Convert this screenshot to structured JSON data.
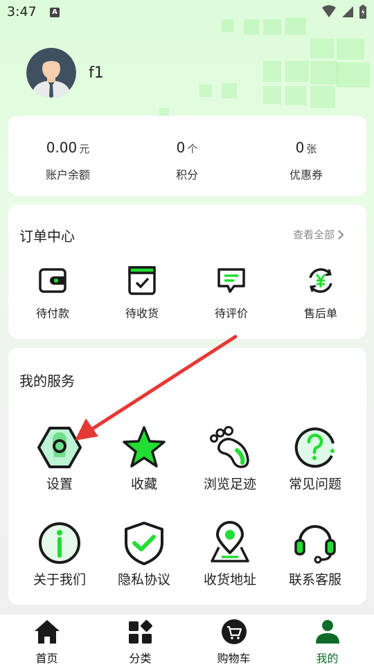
{
  "status_bar": {
    "time": "3:47",
    "notification_badge": "A"
  },
  "profile": {
    "username": "f1"
  },
  "balance_stats": [
    {
      "value": "0.00",
      "unit": "元",
      "label": "账户余额"
    },
    {
      "value": "0",
      "unit": "个",
      "label": "积分"
    },
    {
      "value": "0",
      "unit": "张",
      "label": "优惠券"
    }
  ],
  "orders": {
    "title": "订单中心",
    "view_all": "查看全部",
    "items": [
      {
        "label": "待付款",
        "icon": "wallet-icon"
      },
      {
        "label": "待收货",
        "icon": "package-icon"
      },
      {
        "label": "待评价",
        "icon": "comment-icon"
      },
      {
        "label": "售后单",
        "icon": "refund-icon"
      }
    ]
  },
  "services": {
    "title": "我的服务",
    "items": [
      {
        "label": "设置",
        "icon": "settings-hex-icon"
      },
      {
        "label": "收藏",
        "icon": "star-icon"
      },
      {
        "label": "浏览足迹",
        "icon": "footprint-icon"
      },
      {
        "label": "常见问题",
        "icon": "question-icon"
      },
      {
        "label": "关于我们",
        "icon": "info-icon"
      },
      {
        "label": "隐私协议",
        "icon": "shield-check-icon"
      },
      {
        "label": "收货地址",
        "icon": "location-icon"
      },
      {
        "label": "联系客服",
        "icon": "headset-icon"
      }
    ]
  },
  "tabbar": {
    "items": [
      {
        "label": "首页",
        "icon": "home-icon",
        "active": false
      },
      {
        "label": "分类",
        "icon": "category-icon",
        "active": false
      },
      {
        "label": "购物车",
        "icon": "cart-icon",
        "active": false
      },
      {
        "label": "我的",
        "icon": "person-icon",
        "active": true
      }
    ]
  },
  "colors": {
    "accent": "#22dd33",
    "active_tab": "#0e6b2a",
    "annotation_arrow": "#e53935"
  }
}
